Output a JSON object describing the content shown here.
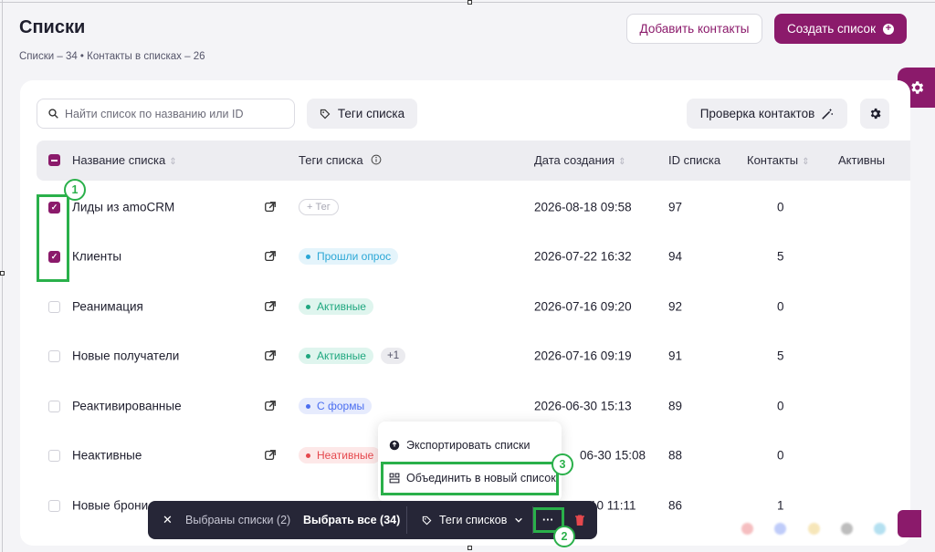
{
  "header": {
    "title": "Списки",
    "subtitle": "Списки – 34 • Контакты в списках – 26",
    "add_contacts_label": "Добавить контакты",
    "create_list_label": "Создать список"
  },
  "toolbar": {
    "search_placeholder": "Найти список по названию или ID",
    "tags_filter_label": "Теги списка",
    "check_contacts_label": "Проверка контактов"
  },
  "table": {
    "columns": [
      "Название списка",
      "Теги списка",
      "Дата создания",
      "ID списка",
      "Контакты",
      "Активны"
    ],
    "rows": [
      {
        "name": "Лиды из amoCRM",
        "checked": true,
        "tags": [
          {
            "label": "+ Тег",
            "kind": "empty"
          }
        ],
        "date": "2026-08-18 09:58",
        "id": "97",
        "contacts": "0"
      },
      {
        "name": "Клиенты",
        "checked": true,
        "tags": [
          {
            "label": "Прошли опрос",
            "kind": "cyan"
          }
        ],
        "date": "2026-07-22 16:32",
        "id": "94",
        "contacts": "5"
      },
      {
        "name": "Реанимация",
        "checked": false,
        "tags": [
          {
            "label": "Активные",
            "kind": "green"
          }
        ],
        "date": "2026-07-16 09:20",
        "id": "92",
        "contacts": "0"
      },
      {
        "name": "Новые получатели",
        "checked": false,
        "tags": [
          {
            "label": "Активные",
            "kind": "green"
          }
        ],
        "extra_tags": "+1",
        "date": "2026-07-16 09:19",
        "id": "91",
        "contacts": "5"
      },
      {
        "name": "Реактивированные",
        "checked": false,
        "tags": [
          {
            "label": "С формы",
            "kind": "blue"
          }
        ],
        "date": "2026-06-30 15:13",
        "id": "89",
        "contacts": "0"
      },
      {
        "name": "Неактивные",
        "checked": false,
        "tags": [
          {
            "label": "Неативные",
            "kind": "red"
          }
        ],
        "date": "06-30 15:08",
        "id": "88",
        "contacts": "0"
      },
      {
        "name": "Новые брони",
        "checked": false,
        "tags": [],
        "date": "10 11:11",
        "id": "86",
        "contacts": "1"
      }
    ]
  },
  "context_menu": {
    "items": [
      {
        "label": "Экспортировать списки",
        "icon": "export-icon"
      },
      {
        "label": "Объединить в новый список",
        "icon": "merge-icon"
      }
    ]
  },
  "bulk_bar": {
    "selected_label": "Выбраны списки (2)",
    "select_all_label": "Выбрать все (34)",
    "tags_label": "Теги списков",
    "more_label": "···"
  },
  "annotations": [
    "1",
    "2",
    "3"
  ],
  "colors": {
    "brand": "#8b1a6b",
    "highlight": "#2ab04a",
    "bulk_bar": "#262637"
  }
}
